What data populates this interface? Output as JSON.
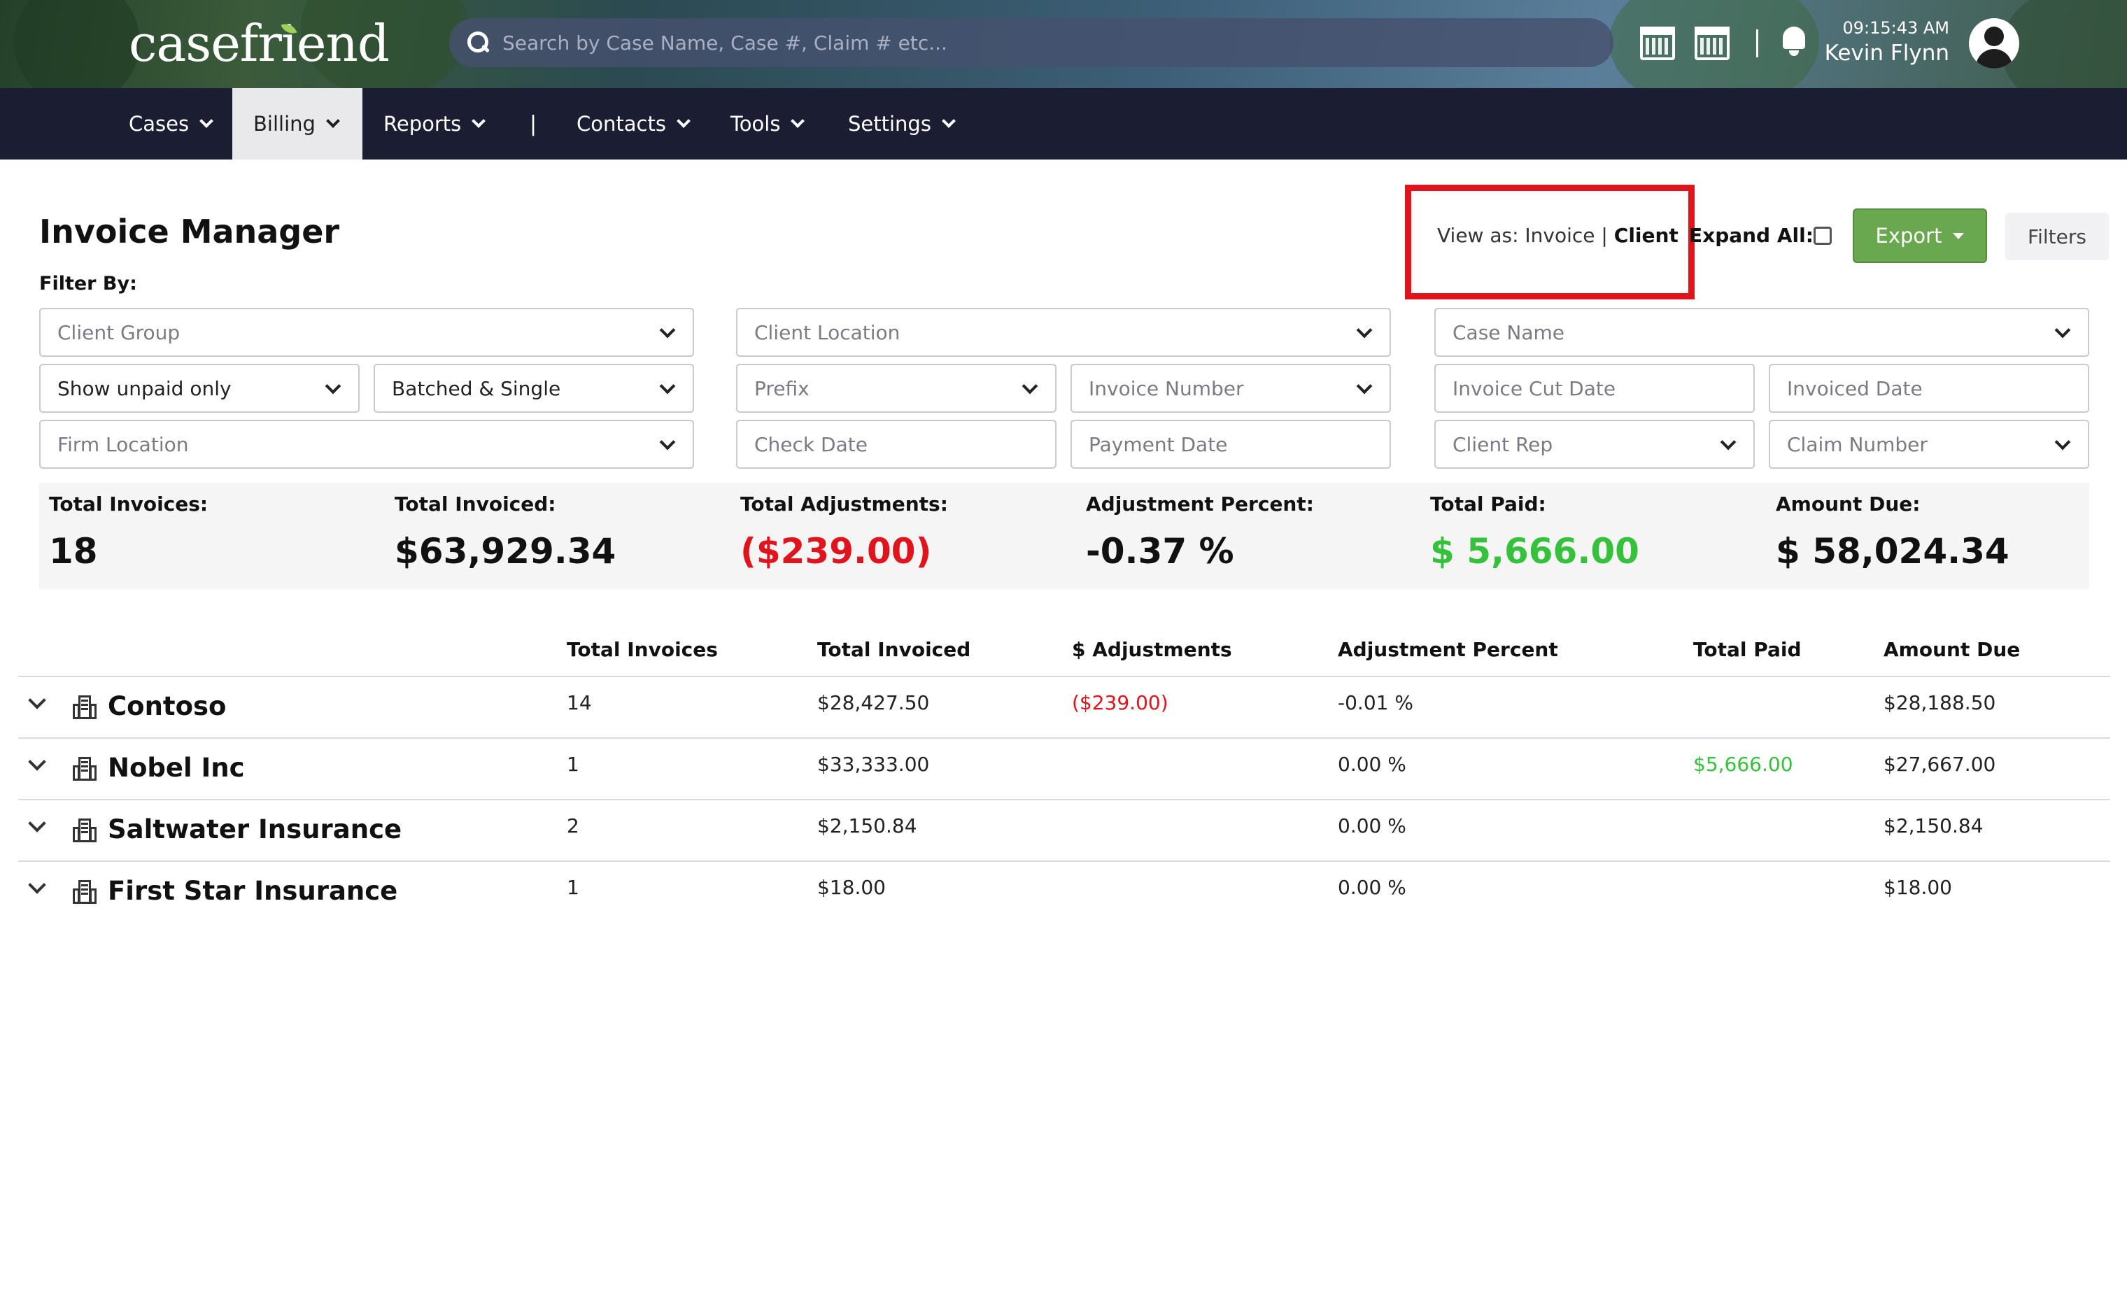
{
  "header": {
    "logo": "casefriend",
    "search_placeholder": "Search by Case Name, Case #, Claim # etc...",
    "time": "09:15:43 AM",
    "user": "Kevin Flynn"
  },
  "nav": {
    "items": [
      {
        "label": "Cases"
      },
      {
        "label": "Billing",
        "active": true
      },
      {
        "label": "Reports"
      },
      {
        "label": "Contacts"
      },
      {
        "label": "Tools"
      },
      {
        "label": "Settings"
      }
    ],
    "separator": "|"
  },
  "page": {
    "title": "Invoice Manager",
    "filter_by": "Filter By:",
    "view_as_prefix": "View as: Invoice | ",
    "view_as_selected": "Client",
    "expand_all": "Expand All:",
    "export": "Export",
    "filters": "Filters"
  },
  "filters": {
    "client_group": "Client Group",
    "client_location": "Client Location",
    "case_name": "Case Name",
    "show_unpaid": "Show unpaid only",
    "batched_single": "Batched & Single",
    "prefix": "Prefix",
    "invoice_number": "Invoice Number",
    "invoice_cut_date": "Invoice Cut Date",
    "invoiced_date": "Invoiced Date",
    "firm_location": "Firm Location",
    "check_date": "Check Date",
    "payment_date": "Payment Date",
    "client_rep": "Client Rep",
    "claim_number": "Claim Number"
  },
  "summary": {
    "total_invoices_label": "Total Invoices:",
    "total_invoices": "18",
    "total_invoiced_label": "Total Invoiced:",
    "total_invoiced": "$63,929.34",
    "total_adjustments_label": "Total Adjustments:",
    "total_adjustments": "($239.00)",
    "adjustment_percent_label": "Adjustment Percent:",
    "adjustment_percent": "-0.37 %",
    "total_paid_label": "Total Paid:",
    "total_paid": "$ 5,666.00",
    "amount_due_label": "Amount Due:",
    "amount_due": "$ 58,024.34"
  },
  "table": {
    "columns": [
      "Total Invoices",
      "Total Invoiced",
      "$ Adjustments",
      "Adjustment Percent",
      "Total Paid",
      "Amount Due"
    ],
    "rows": [
      {
        "client": "Contoso",
        "invoices": "14",
        "invoiced": "$28,427.50",
        "adjustments": "($239.00)",
        "percent": "-0.01 %",
        "paid": "",
        "due": "$28,188.50"
      },
      {
        "client": "Nobel Inc",
        "invoices": "1",
        "invoiced": "$33,333.00",
        "adjustments": "",
        "percent": "0.00 %",
        "paid": "$5,666.00",
        "due": "$27,667.00"
      },
      {
        "client": "Saltwater Insurance",
        "invoices": "2",
        "invoiced": "$2,150.84",
        "adjustments": "",
        "percent": "0.00 %",
        "paid": "",
        "due": "$2,150.84"
      },
      {
        "client": "First Star Insurance",
        "invoices": "1",
        "invoiced": "$18.00",
        "adjustments": "",
        "percent": "0.00 %",
        "paid": "",
        "due": "$18.00"
      }
    ]
  },
  "colors": {
    "navbar": "#1b1e33",
    "export": "#6aa84f",
    "negative": "#e0141c",
    "positive": "#35c13b",
    "highlight_box": "#e0141c"
  }
}
